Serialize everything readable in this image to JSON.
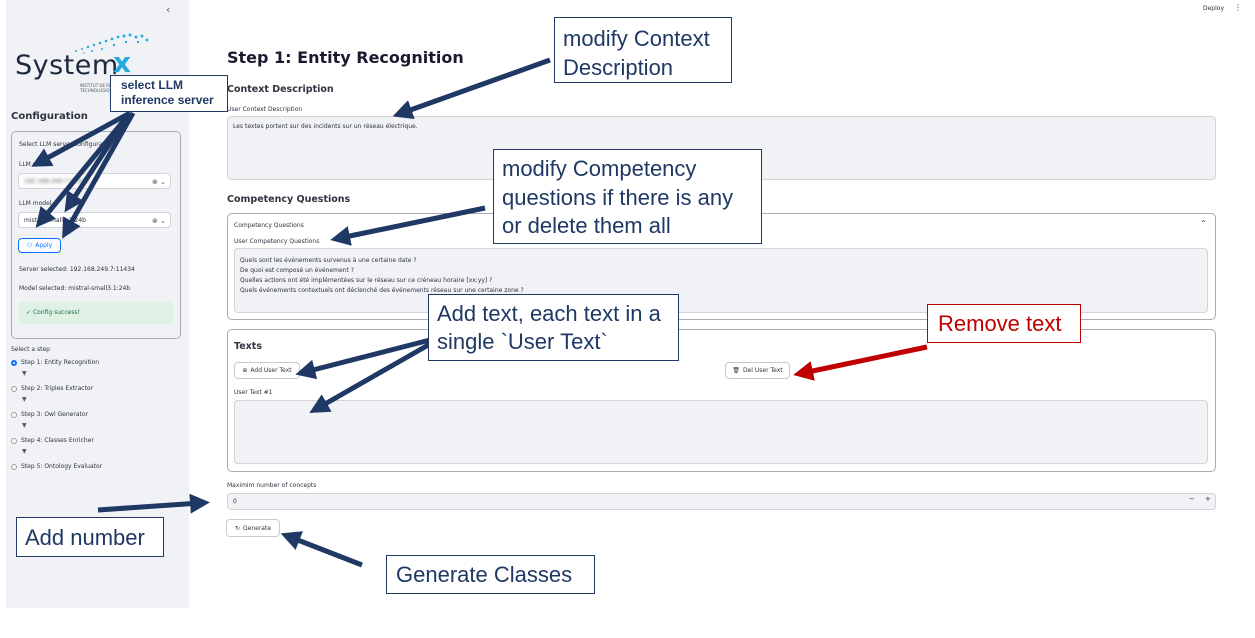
{
  "header": {
    "deploy_label": "Deploy",
    "menu_glyph": "⋮"
  },
  "sidebar": {
    "collapse_glyph": "‹",
    "logo": {
      "main": "System",
      "accent": "x",
      "sub1": "INSTITUT DE RECHERCHE",
      "sub2": "TECHNOLOGIQUE"
    },
    "config_heading": "Configuration",
    "select_llm_label": "Select LLM server configuration",
    "llm_server_label": "LLM server",
    "llm_server_value": "192.168.249.7:11434",
    "llm_model_label": "LLM model",
    "llm_model_value": "mistral-small3.1:24b",
    "apply_label": "Apply",
    "server_selected": "Server selected: 192.168.249.7:11434",
    "model_selected": "Model selected: mistral-small3.1:24b",
    "success_msg": "Config success!",
    "select_step_label": "Select a step",
    "steps": [
      {
        "label": "Step 1: Entity Recognition"
      },
      {
        "label": "Step 2: Triples Extractor"
      },
      {
        "label": "Step 3: Owl Generator"
      },
      {
        "label": "Step 4: Classes Enricher"
      },
      {
        "label": "Step 5: Ontology Evaluator"
      }
    ]
  },
  "main": {
    "title": "Step 1: Entity Recognition",
    "context_heading": "Context Description",
    "context_label": "User Context Description",
    "context_value": "Les textes portent sur des incidents sur un réseau électrique.",
    "cq_heading": "Competency Questions",
    "cq_expander": "Competency Questions",
    "cq_label": "User Competency Questions",
    "cq_lines": [
      "Quels sont les événements survenus à une certaine date ?",
      "De quoi est composé un événement ?",
      "Quelles actions ont été implémentées sur le réseau sur ce créneau horaire [xx;yy] ?",
      "Quels événements contextuels ont déclenché des événements réseau sur une certaine zone ?"
    ],
    "texts_heading": "Texts",
    "add_text_label": "Add User Text",
    "del_text_label": "Del User Text",
    "user_text_label": "User Text #1",
    "max_concepts_label": "Maximim number of concepts",
    "max_concepts_value": "0",
    "stepper_minus": "−",
    "stepper_plus": "+",
    "generate_label": "Generate"
  },
  "annotations": {
    "llm": "select LLM inference server",
    "context": "modify Context Description",
    "competency": "modify Competency questions if there is any or delete them all",
    "add_text": "Add text, each text in a single `User Text`",
    "remove_text": "Remove text",
    "add_number": "Add number",
    "generate": "Generate Classes"
  },
  "colors": {
    "annotation_blue": "#1f3864",
    "annotation_red": "#c00000",
    "sidebar_bg": "#f0f2f6"
  }
}
